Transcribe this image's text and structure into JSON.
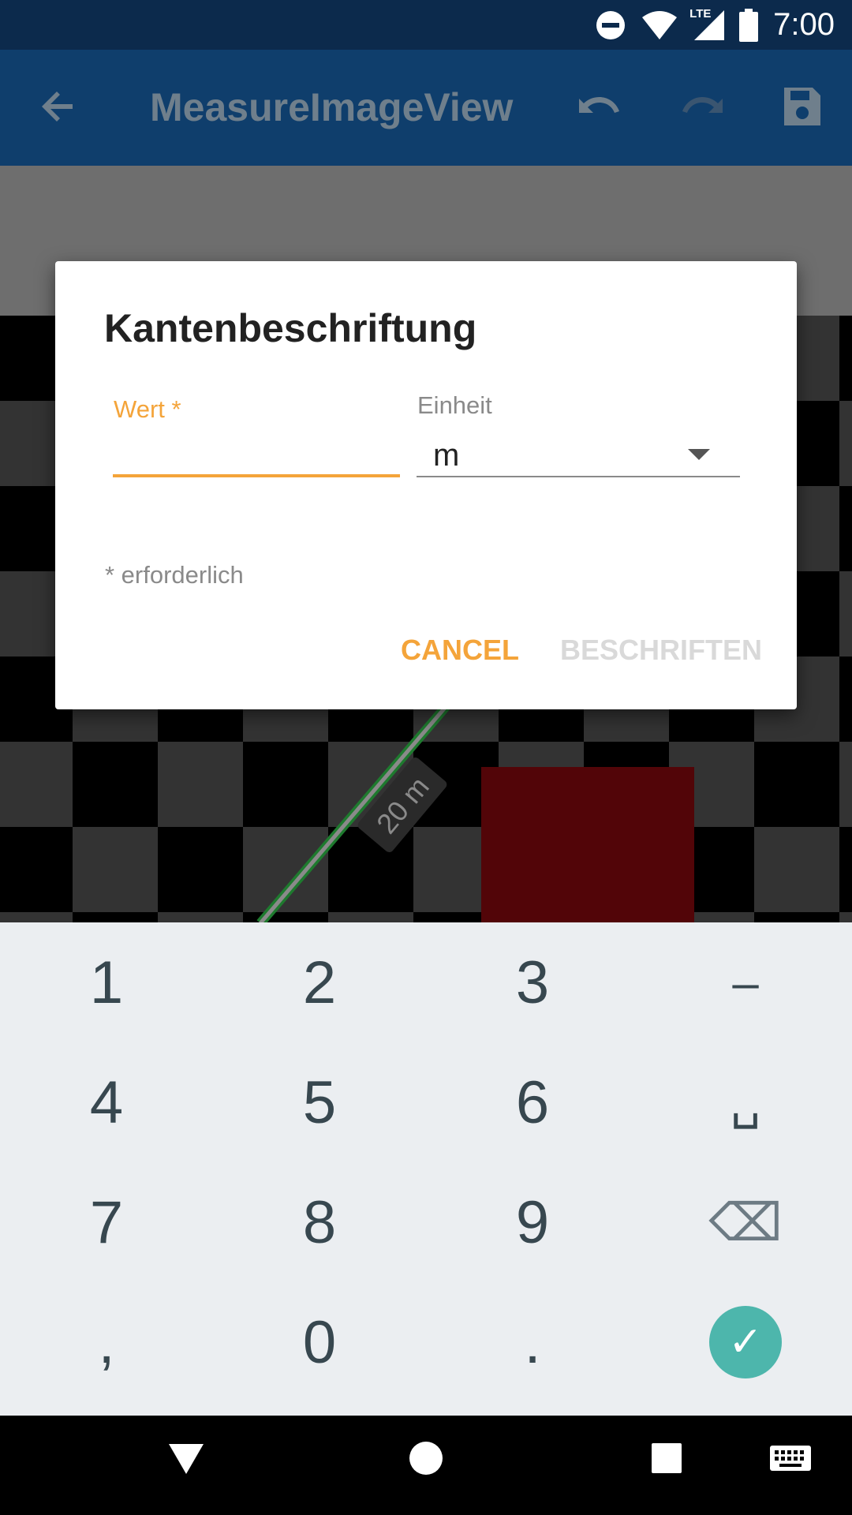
{
  "status_bar": {
    "time": "7:00",
    "network": "LTE",
    "icons": [
      "do-not-disturb-icon",
      "wifi-icon",
      "cell-signal-icon",
      "battery-icon"
    ]
  },
  "app_bar": {
    "title": "MeasureImageView",
    "icons": [
      "back-arrow-icon",
      "undo-icon",
      "redo-icon",
      "save-icon"
    ]
  },
  "canvas": {
    "edge_label": "20 m"
  },
  "dialog": {
    "title": "Kantenbeschriftung",
    "value_label": "Wert *",
    "value_input": "",
    "unit_label": "Einheit",
    "unit_value": "m",
    "required_note": "* erforderlich",
    "cancel_label": "CANCEL",
    "confirm_label": "BESCHRIFTEN"
  },
  "keyboard": {
    "rows": [
      [
        "1",
        "2",
        "3",
        "–"
      ],
      [
        "4",
        "5",
        "6",
        "␣"
      ],
      [
        "7",
        "8",
        "9",
        "⌫"
      ],
      [
        ",",
        "0",
        ".",
        "✓"
      ]
    ],
    "accent_color": "#4db6ac"
  },
  "nav_bar": {
    "icons": [
      "back-triangle-icon",
      "home-circle-icon",
      "recents-square-icon",
      "keyboard-icon"
    ]
  },
  "colors": {
    "status_bar": "#0c2a4c",
    "app_bar": "#0f3e6c",
    "accent": "#f4a43a",
    "disabled": "#d9d9d9"
  }
}
